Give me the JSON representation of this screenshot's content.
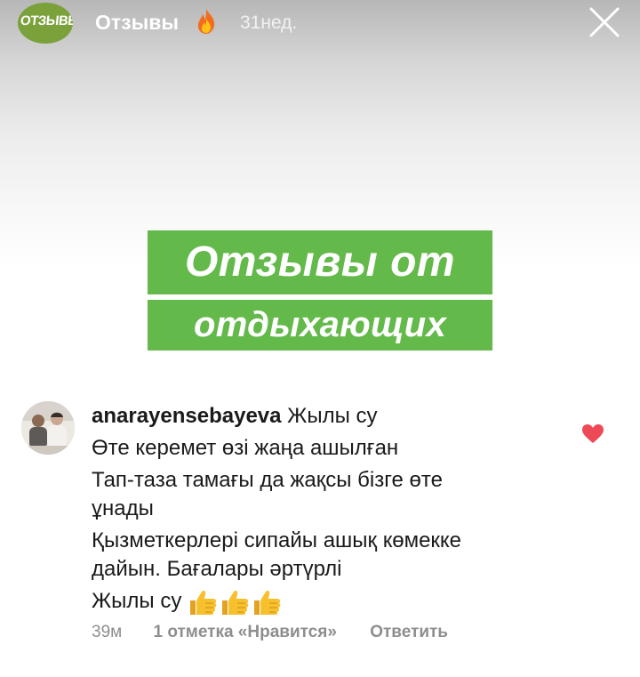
{
  "header": {
    "badge_text": "ОТЗЫВЫ",
    "account_name": "Отзывы",
    "time": "31нед."
  },
  "banner": {
    "line1": "Отзывы от",
    "line2": "отдыхающих",
    "color": "#64b94b"
  },
  "comment": {
    "username": "anarayensebayeva",
    "lines": [
      "Жылы су",
      "Өте керемет өзі жаңа ашылған",
      "Тап-таза тамағы да жақсы бізге өте",
      "ұнады",
      "Қызметкерлері сипайы ашық көмекке",
      "дайын. Бағалары әртүрлі",
      "Жылы су"
    ],
    "emoji": [
      "thumbs-up-icon",
      "thumbs-up-icon",
      "thumbs-up-icon"
    ],
    "meta": {
      "time": "39м",
      "likes": "1 отметка «Нравится»",
      "reply": "Ответить"
    },
    "liked": true,
    "heart_color": "#ed4956"
  }
}
